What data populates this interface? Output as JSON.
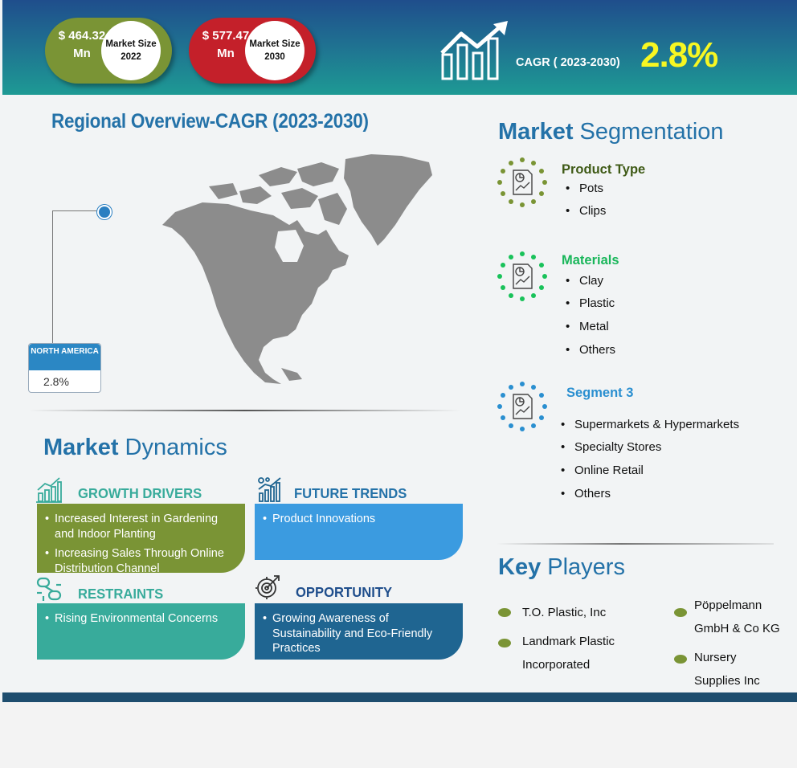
{
  "header": {
    "size_2022": {
      "amount": "$ 464.32 Mn",
      "label": "Market Size 2022"
    },
    "size_2030": {
      "amount": "$ 577.47 Mn",
      "label": "Market Size 2030"
    },
    "cagr_label": "CAGR ( 2023-2030)",
    "cagr_value": "2.8%",
    "colors": {
      "green": "#7a9435",
      "red": "#c4202a",
      "cagr_value": "#f7f722"
    }
  },
  "regional": {
    "title": "Regional Overview-CAGR (2023-2030)",
    "region_name": "NORTH AMERICA",
    "region_value": "2.8%",
    "map_icon": "north-america-map"
  },
  "segmentation": {
    "title_bold": "Market",
    "title_rest": " Segmentation",
    "segments": [
      {
        "title": "Product Type",
        "color": "#3f5a16",
        "icon_color": "#7a9435",
        "items": [
          "Pots",
          "Clips"
        ]
      },
      {
        "title": "Materials",
        "color": "#19b65a",
        "icon_color": "#19c25a",
        "items": [
          "Clay",
          "Plastic",
          "Metal",
          "Others"
        ]
      },
      {
        "title": "Segment 3",
        "color": "#2a8fd0",
        "icon_color": "#2a8fd0",
        "items": [
          "Supermarkets & Hypermarkets",
          "Specialty Stores",
          "Online Retail",
          "Others"
        ]
      }
    ]
  },
  "dynamics": {
    "title_bold": "Market",
    "title_rest": " Dynamics",
    "growth_drivers": {
      "title": "GROWTH DRIVERS",
      "icon": "bar-chart-growth-icon",
      "items": [
        "Increased Interest in Gardening and Indoor Planting",
        "Increasing Sales Through Online Distribution Channel"
      ]
    },
    "future_trends": {
      "title": "FUTURE TRENDS",
      "icon": "trend-chart-icon",
      "items": [
        "Product Innovations"
      ]
    },
    "restraints": {
      "title": "RESTRAINTS",
      "icon": "broken-chain-icon",
      "items": [
        "Rising Environmental Concerns"
      ]
    },
    "opportunity": {
      "title": "OPPORTUNITY",
      "icon": "target-gear-icon",
      "items": [
        "Growing Awareness of Sustainability and Eco-Friendly Practices"
      ]
    }
  },
  "key_players": {
    "title_bold": "Key",
    "title_rest": " Players",
    "players": [
      "T.O. Plastic, Inc",
      "Landmark Plastic Incorporated",
      "Pöppelmann GmbH & Co KG",
      "Nursery Supplies Inc"
    ]
  }
}
